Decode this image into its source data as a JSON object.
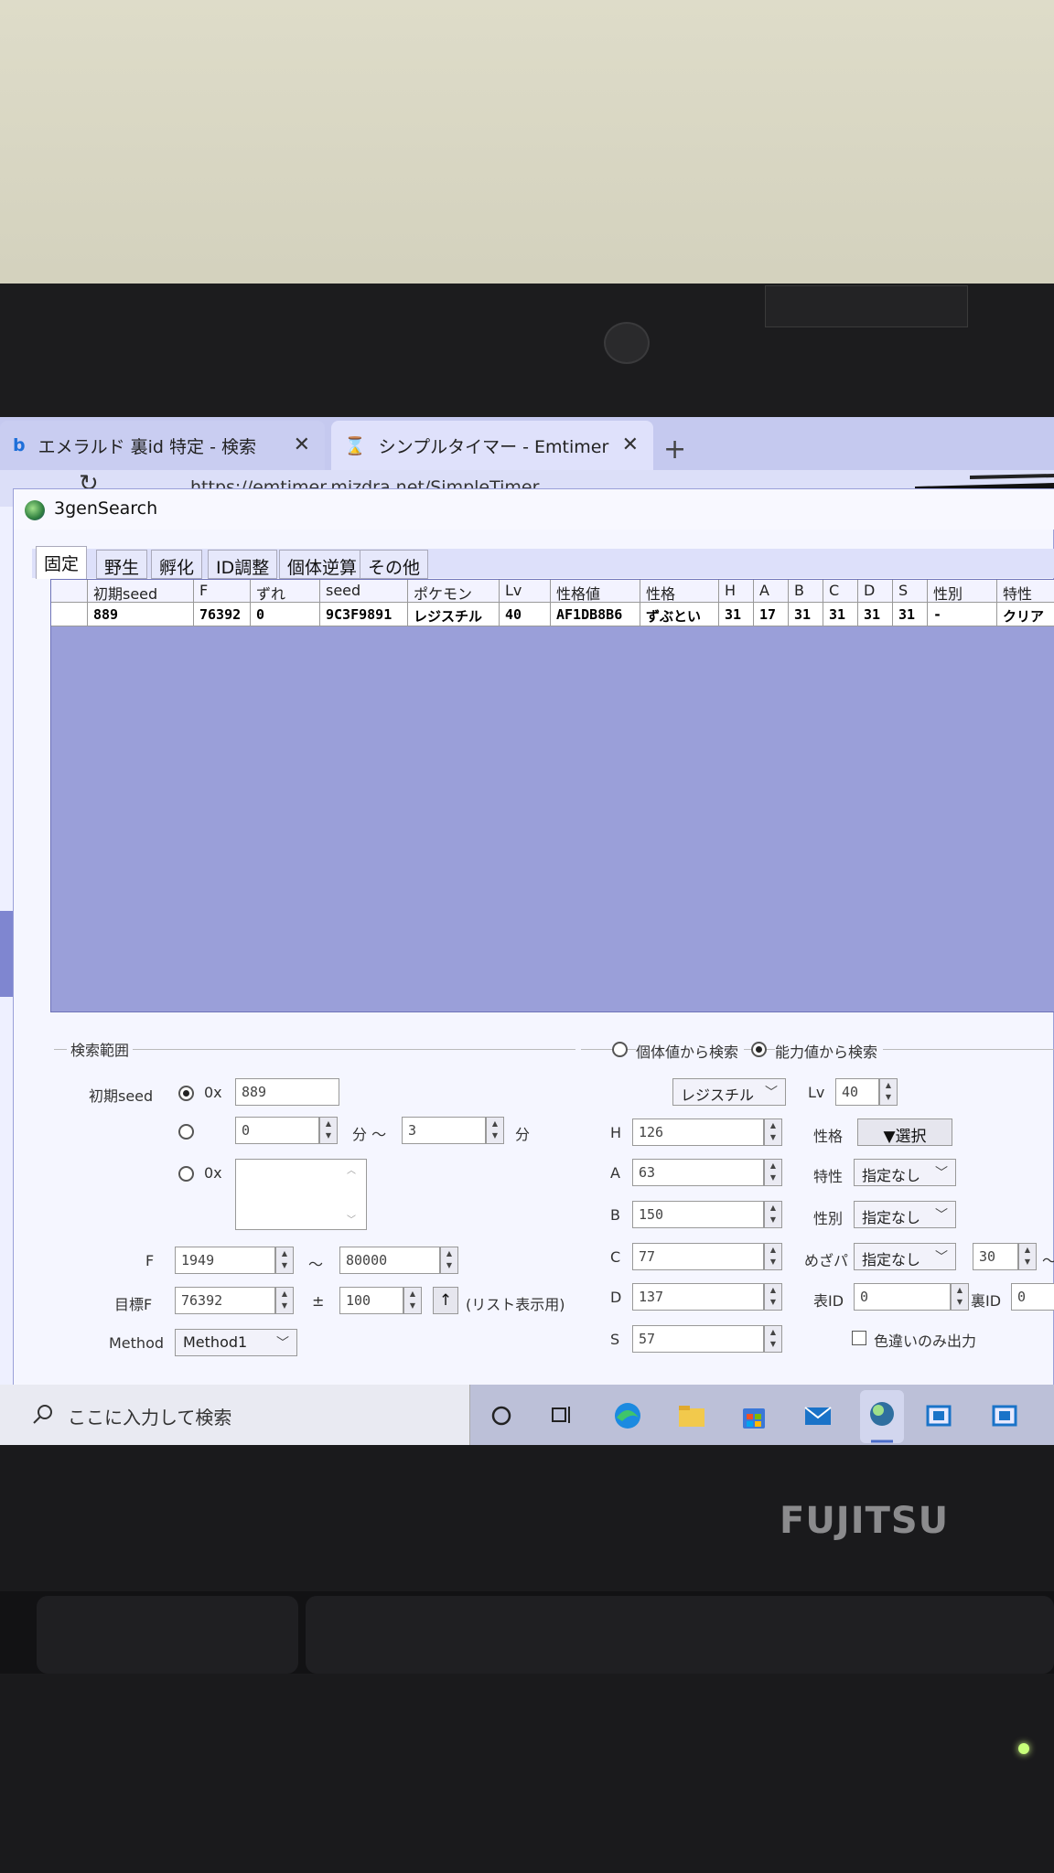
{
  "browser": {
    "tabs": [
      {
        "label": "エメラルド 裏id 特定 - 検索",
        "icon": "bing-icon"
      },
      {
        "label": "シンプルタイマー - Emtimer",
        "icon": "hourglass-icon"
      }
    ],
    "new_tab": "+",
    "url": "https://emtimer.mizdra.net/SimpleTimer"
  },
  "app": {
    "title": "3genSearch",
    "tabs": [
      "固定",
      "野生",
      "孵化",
      "ID調整",
      "個体逆算",
      "その他"
    ],
    "active_tab": "固定",
    "grid": {
      "headers": [
        "",
        "初期seed",
        "F",
        "ずれ",
        "seed",
        "ポケモン",
        "Lv",
        "性格値",
        "性格",
        "H",
        "A",
        "B",
        "C",
        "D",
        "S",
        "性別",
        "特性"
      ],
      "rows": [
        [
          "",
          "889",
          "76392",
          "0",
          "9C3F9891",
          "レジスチル",
          "40",
          "AF1DB8B6",
          "ずぶとい",
          "31",
          "17",
          "31",
          "31",
          "31",
          "31",
          "-",
          "クリア"
        ]
      ]
    },
    "search_range": {
      "group_label": "検索範囲",
      "initial_seed_label": "初期seed",
      "prefix_0x": "0x",
      "initial_seed_value": "889",
      "minutes_from": "0",
      "minutes_unit_tilde": "分 〜",
      "minutes_to": "3",
      "minutes_unit": "分",
      "seed_list_prefix": "0x",
      "f_label": "F",
      "f_from": "1949",
      "tilde": "〜",
      "f_to": "80000",
      "target_f_label": "目標F",
      "target_f": "76392",
      "plusminus": "±",
      "range": "100",
      "up_button": "↑",
      "list_display_note": "(リスト表示用)",
      "method_label": "Method",
      "method_value": "Method1"
    },
    "mode": {
      "from_iv": "個体値から検索",
      "from_stats": "能力値から検索",
      "selected": "from_stats"
    },
    "stats": {
      "pokemon": "レジスチル",
      "lv_label": "Lv",
      "lv": "40",
      "H_label": "H",
      "H": "126",
      "A_label": "A",
      "A": "63",
      "B_label": "B",
      "B": "150",
      "C_label": "C",
      "C": "77",
      "D_label": "D",
      "D": "137",
      "S_label": "S",
      "S": "57",
      "nature_label": "性格",
      "nature_button": "▼選択",
      "ability_label": "特性",
      "ability_value": "指定なし",
      "gender_label": "性別",
      "gender_value": "指定なし",
      "hp_label": "めざパ",
      "hp_value": "指定なし",
      "hp_power": "30",
      "hp_tilde": "〜",
      "tid_label": "表ID",
      "tid": "0",
      "sid_label": "裏ID",
      "sid": "0",
      "shiny_only": "色違いのみ出力"
    }
  },
  "taskbar": {
    "search_placeholder": "ここに入力して検索"
  },
  "laptop": {
    "brand": "FUJITSU"
  },
  "colors": {
    "grid_background": "#9a9fd9",
    "browser_tab": "#c9cdf1",
    "taskbar": "#bcc0d8"
  }
}
